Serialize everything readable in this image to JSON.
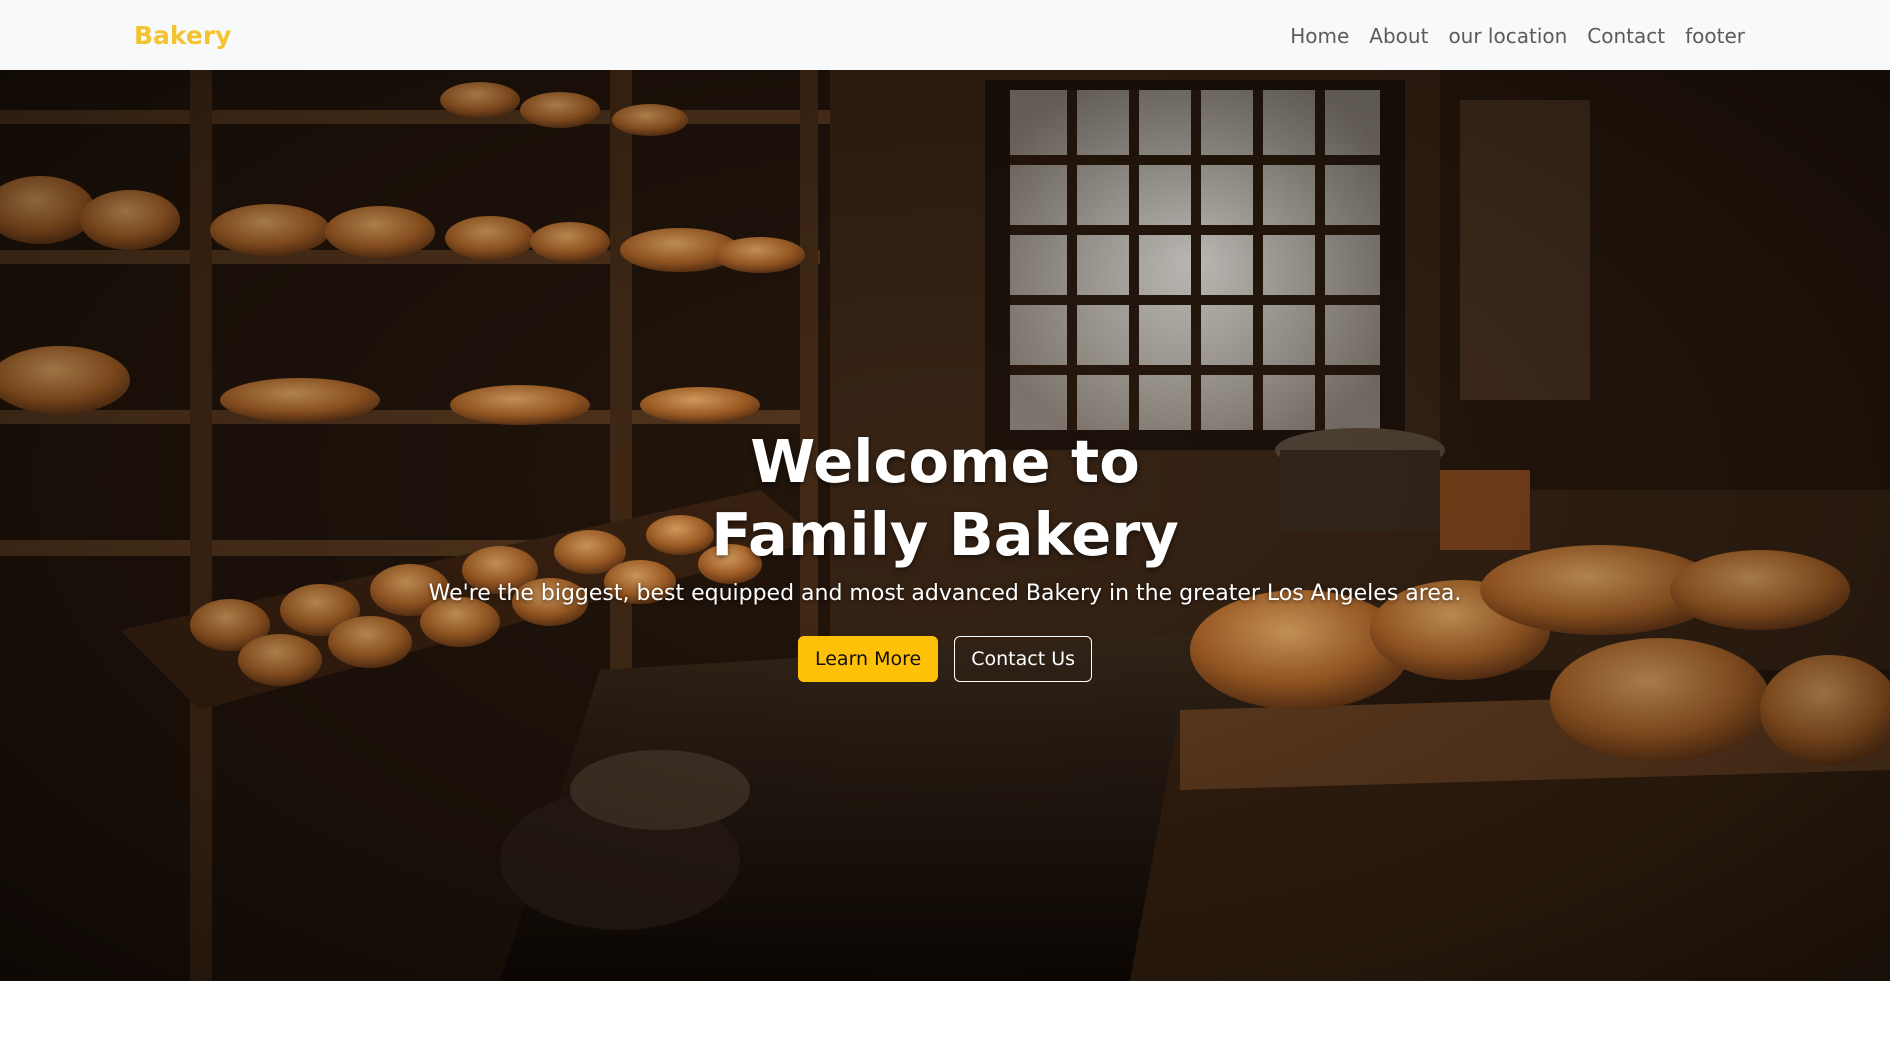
{
  "navbar": {
    "brand": "Bakery",
    "links": [
      "Home",
      "About",
      "our location",
      "Contact",
      "footer"
    ]
  },
  "hero": {
    "title_line1": "Welcome to",
    "title_line2": "Family Bakery",
    "subtitle": "We're the biggest, best equipped and most advanced Bakery in the greater Los Angeles area.",
    "primary_button": "Learn More",
    "secondary_button": "Contact Us"
  },
  "colors": {
    "brand": "#f4c430",
    "navbar_bg": "#f8f9fa",
    "primary_button": "#ffc107",
    "hero_text": "#ffffff"
  }
}
